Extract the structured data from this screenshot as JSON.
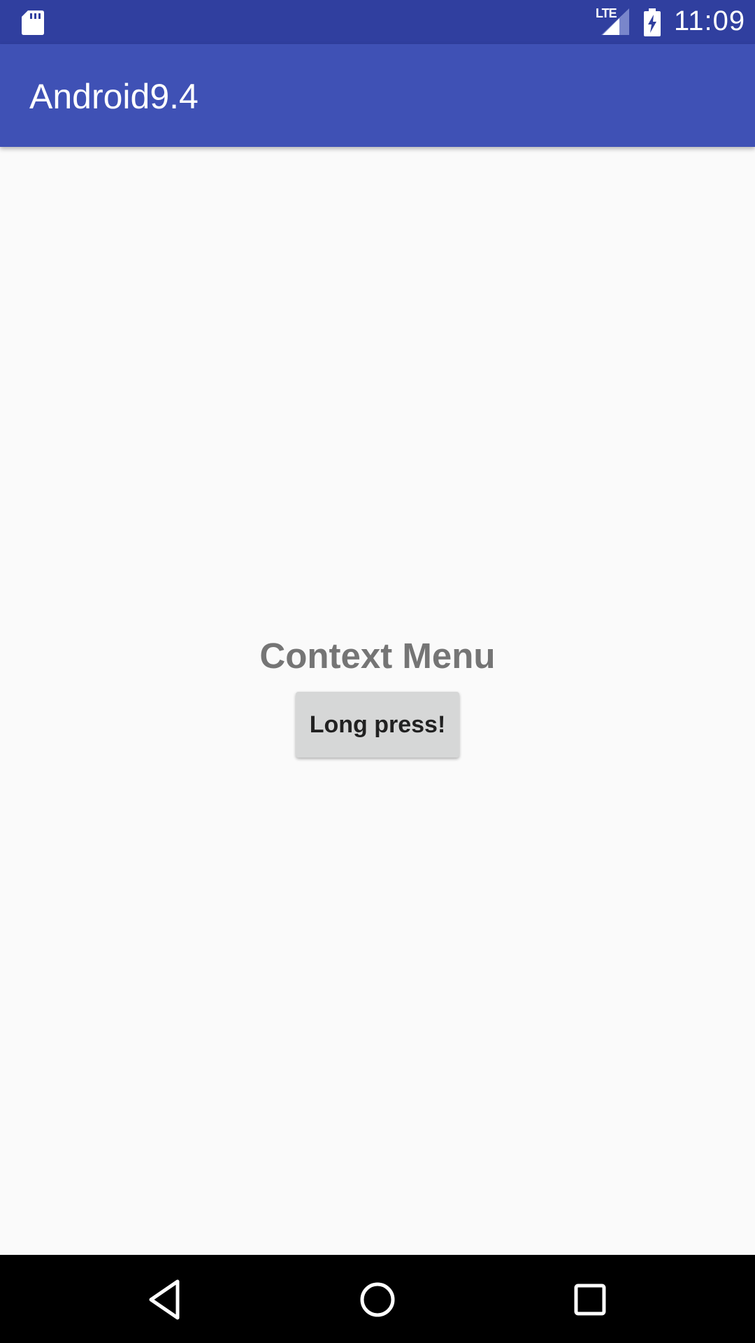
{
  "status_bar": {
    "network_type": "LTE",
    "time": "11:09",
    "icons": [
      "sd-card-icon",
      "signal-icon",
      "battery-charging-icon"
    ]
  },
  "app_bar": {
    "title": "Android9.4"
  },
  "main": {
    "heading": "Context Menu",
    "button_label": "Long press!"
  },
  "nav_bar": {
    "icons": [
      "back-icon",
      "home-icon",
      "recents-icon"
    ]
  },
  "colors": {
    "status_bar": "#303f9f",
    "app_bar": "#3f51b5",
    "background": "#fafafa",
    "heading_text": "#757575",
    "button_bg": "#d6d7d7"
  }
}
